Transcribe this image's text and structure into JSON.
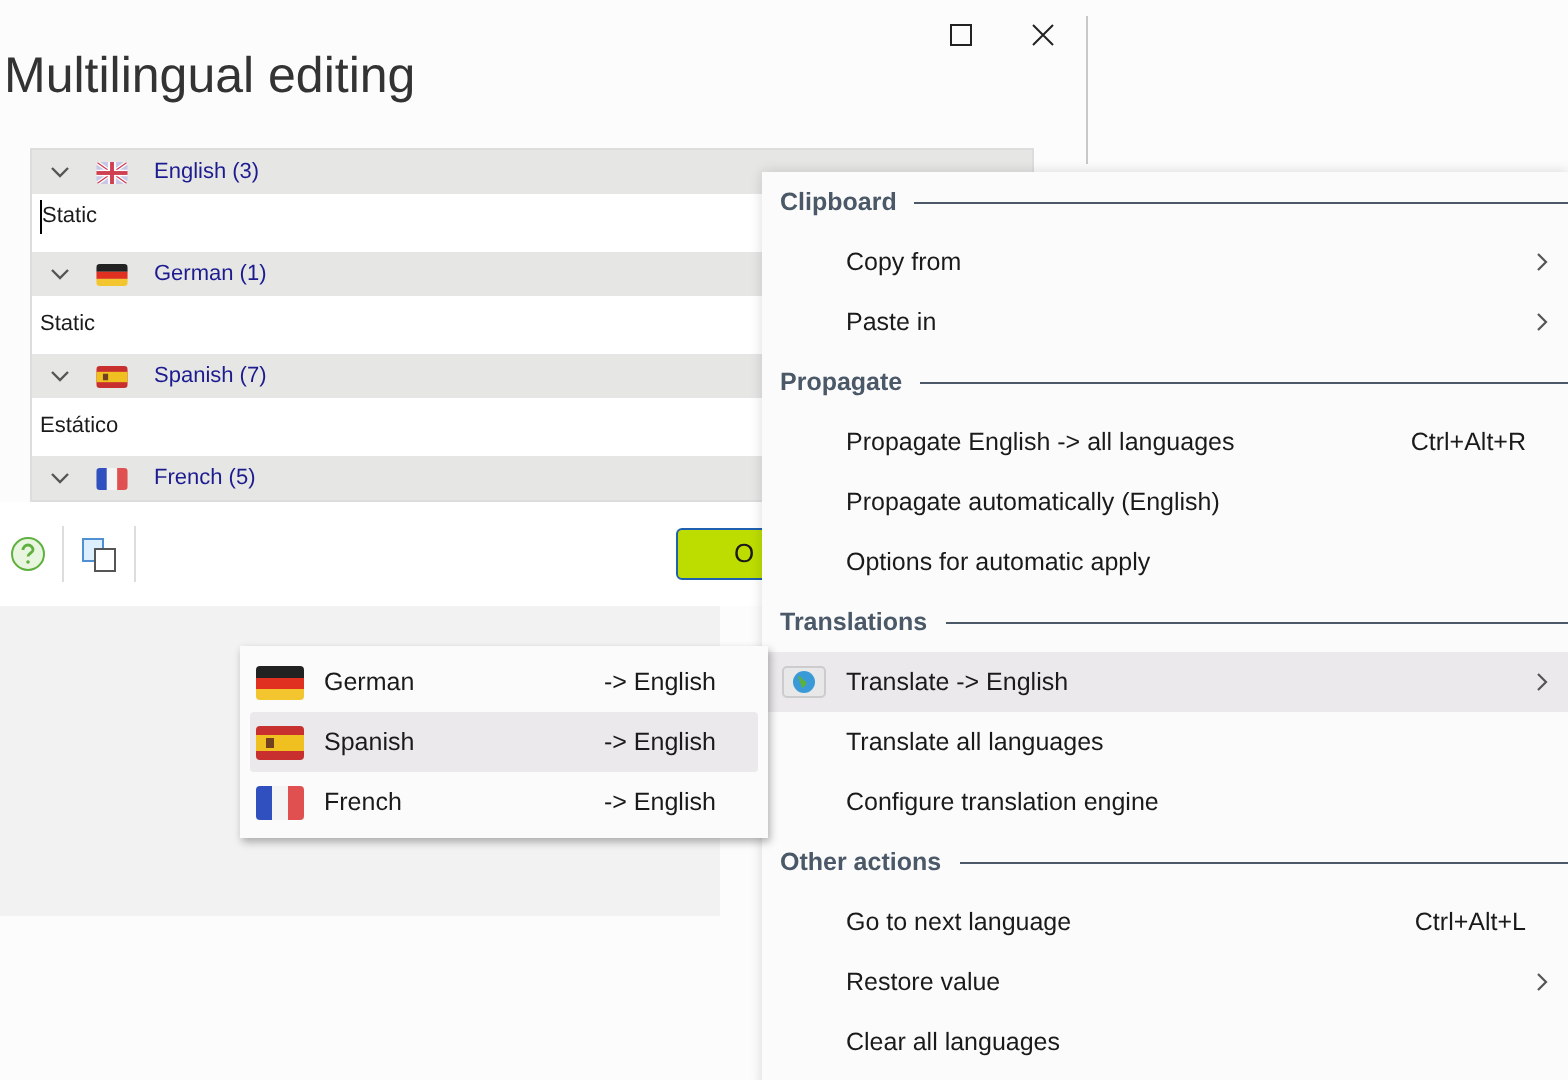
{
  "window": {
    "title": "Multilingual editing"
  },
  "languages": [
    {
      "kind": "uk",
      "label": "English (3)",
      "expanded": true,
      "value": "Static",
      "focused": true
    },
    {
      "kind": "de",
      "label": "German (1)",
      "expanded": true,
      "value": "Static",
      "focused": false
    },
    {
      "kind": "es",
      "label": "Spanish (7)",
      "expanded": true,
      "value": "Estático",
      "focused": false
    },
    {
      "kind": "fr",
      "label": "French (5)",
      "expanded": true
    }
  ],
  "ok_button": {
    "label": "O"
  },
  "context_menu": [
    {
      "kind": "header",
      "label": "Clipboard"
    },
    {
      "kind": "item",
      "label": "Copy from",
      "submenu": true,
      "selected": false
    },
    {
      "kind": "item",
      "label": "Paste in",
      "submenu": true,
      "selected": false
    },
    {
      "kind": "header",
      "label": "Propagate"
    },
    {
      "kind": "item",
      "label": "Propagate English -> all languages",
      "shortcut": "Ctrl+Alt+R",
      "submenu": false,
      "selected": false
    },
    {
      "kind": "item",
      "label": "Propagate automatically (English)",
      "submenu": false,
      "selected": false
    },
    {
      "kind": "item",
      "label": "Options for automatic apply",
      "submenu": false,
      "selected": false
    },
    {
      "kind": "header",
      "label": "Translations"
    },
    {
      "kind": "globe",
      "label": "Translate -> English",
      "submenu": true,
      "selected": true
    },
    {
      "kind": "item",
      "label": "Translate all languages",
      "submenu": false,
      "selected": false
    },
    {
      "kind": "item",
      "label": "Configure translation engine",
      "submenu": false,
      "selected": false
    },
    {
      "kind": "header",
      "label": "Other actions"
    },
    {
      "kind": "item",
      "label": "Go to next language",
      "shortcut": "Ctrl+Alt+L",
      "submenu": false,
      "selected": false
    },
    {
      "kind": "item",
      "label": "Restore value",
      "submenu": true,
      "selected": false
    },
    {
      "kind": "item",
      "label": "Clear all languages",
      "submenu": false,
      "selected": false
    }
  ],
  "submenu": [
    {
      "kind": "de",
      "label": "German",
      "target": "-> English",
      "selected": false
    },
    {
      "kind": "es",
      "label": "Spanish",
      "target": "-> English",
      "selected": true
    },
    {
      "kind": "fr",
      "label": "French",
      "target": "-> English",
      "selected": false
    }
  ]
}
